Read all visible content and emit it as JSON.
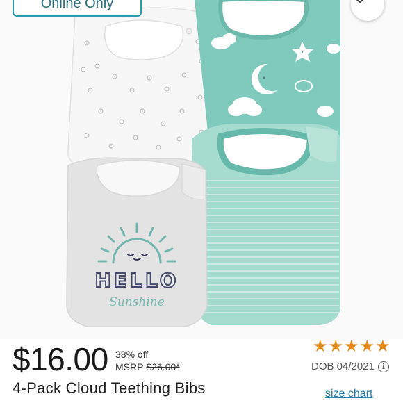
{
  "badge": {
    "label": "Online Only"
  },
  "favorite": {
    "icon": "heart-icon"
  },
  "product_image": {
    "bib_print_text_1": "HELLO",
    "bib_print_text_2": "Sunshine",
    "colors": {
      "teal": "#7fcabd",
      "teal_dark": "#67b9ab",
      "grey": "#e4e4e4",
      "white": "#f6f6f6"
    }
  },
  "pricing": {
    "price": "$16.00",
    "discount": "38% off",
    "msrp_label": "MSRP",
    "msrp_value": "$26.00*"
  },
  "product": {
    "title": "4-Pack Cloud Teething Bibs"
  },
  "rating": {
    "stars": 5,
    "max": 5,
    "color": "#e68a1c"
  },
  "dob": {
    "label": "DOB 04/2021",
    "icon": "info-icon"
  },
  "links": {
    "size_chart": "size chart"
  }
}
